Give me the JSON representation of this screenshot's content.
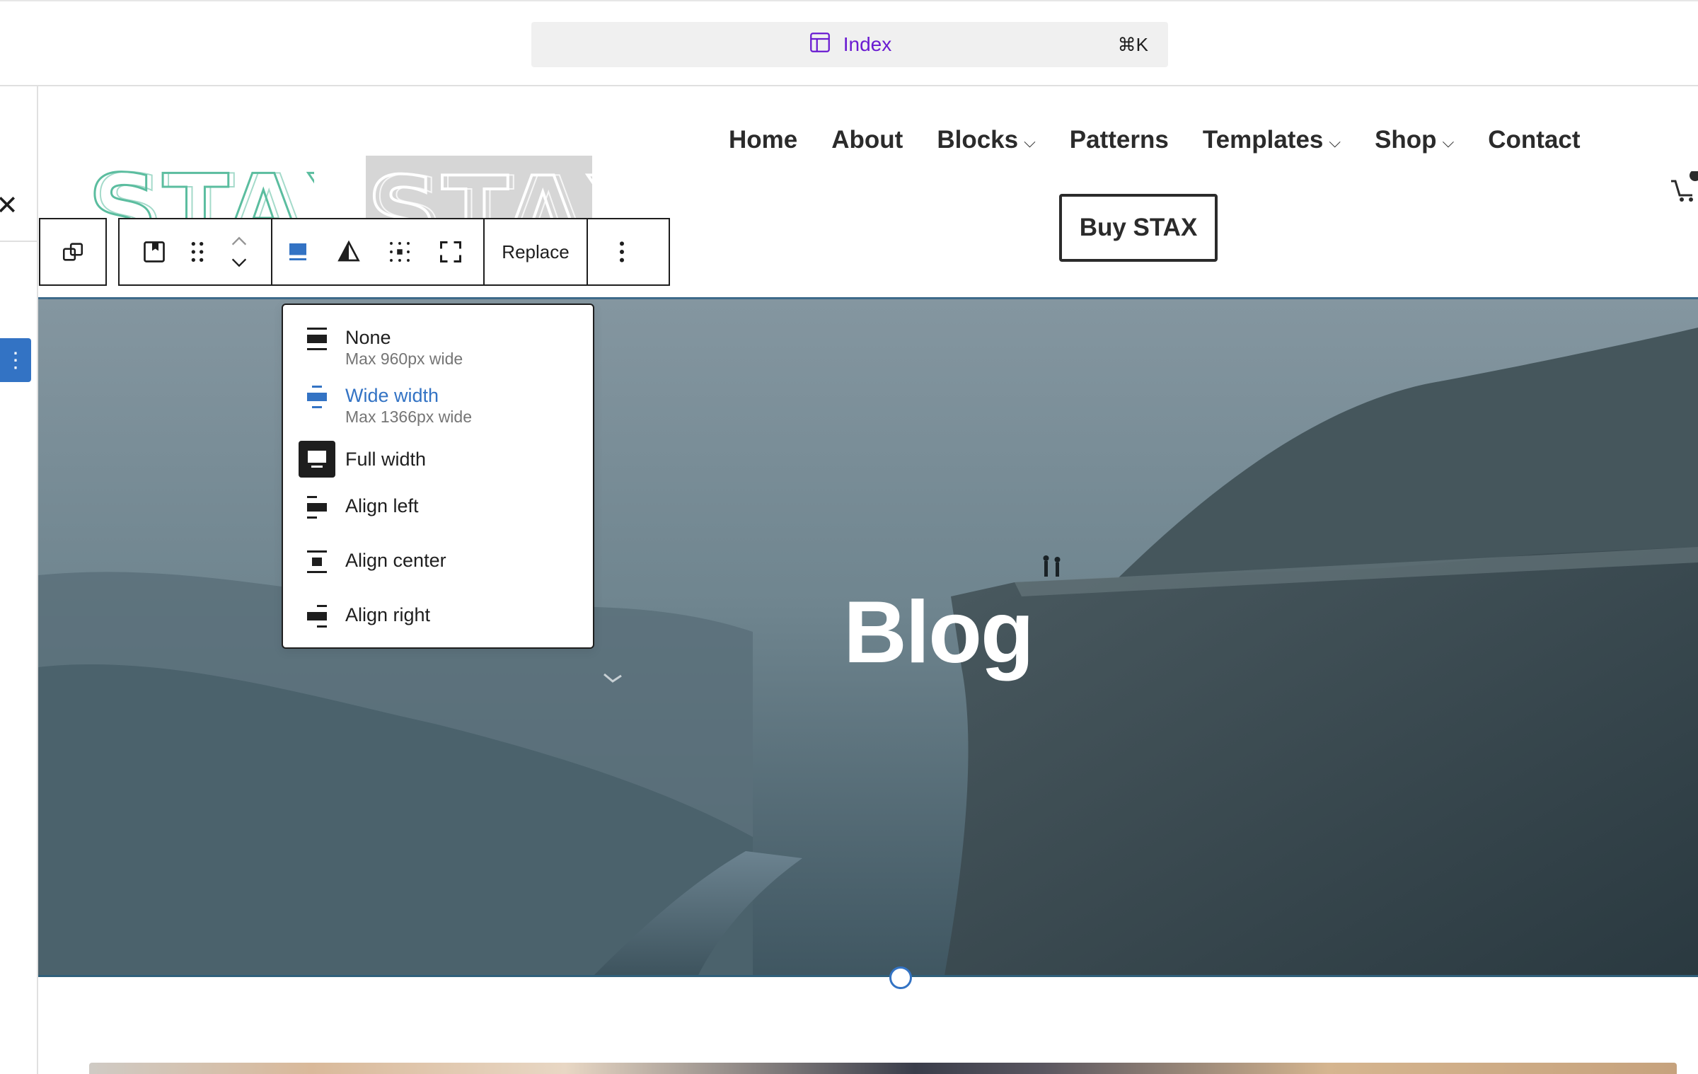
{
  "command_bar": {
    "title": "Index",
    "shortcut": "⌘K"
  },
  "header": {
    "logo_text": "STAX",
    "nav": [
      {
        "label": "Home",
        "has_submenu": false
      },
      {
        "label": "About",
        "has_submenu": false
      },
      {
        "label": "Blocks",
        "has_submenu": true
      },
      {
        "label": "Patterns",
        "has_submenu": false
      },
      {
        "label": "Templates",
        "has_submenu": true
      },
      {
        "label": "Shop",
        "has_submenu": true
      },
      {
        "label": "Contact",
        "has_submenu": false
      }
    ],
    "cta_label": "Buy STAX"
  },
  "toolbar": {
    "replace_label": "Replace",
    "icons": [
      "block-transform-icon",
      "featured-image-icon",
      "drag-handle-icon",
      "move-up-icon",
      "move-down-icon",
      "align-full-icon",
      "duotone-icon",
      "content-position-icon",
      "fullscreen-icon",
      "more-options-icon"
    ]
  },
  "align_menu": {
    "items": [
      {
        "label": "None",
        "sub": "Max 960px wide",
        "icon": "align-none-icon"
      },
      {
        "label": "Wide width",
        "sub": "Max 1366px wide",
        "icon": "align-wide-icon",
        "active": true
      },
      {
        "label": "Full width",
        "icon": "align-full-width-icon",
        "selected": true
      },
      {
        "label": "Align left",
        "icon": "align-left-icon"
      },
      {
        "label": "Align center",
        "icon": "align-center-icon"
      },
      {
        "label": "Align right",
        "icon": "align-right-icon"
      }
    ]
  },
  "cover": {
    "title": "Blog"
  },
  "colors": {
    "accent": "#3373c4",
    "command_purple": "#6a1bd1",
    "logo_teal": "#5bbd9f"
  }
}
